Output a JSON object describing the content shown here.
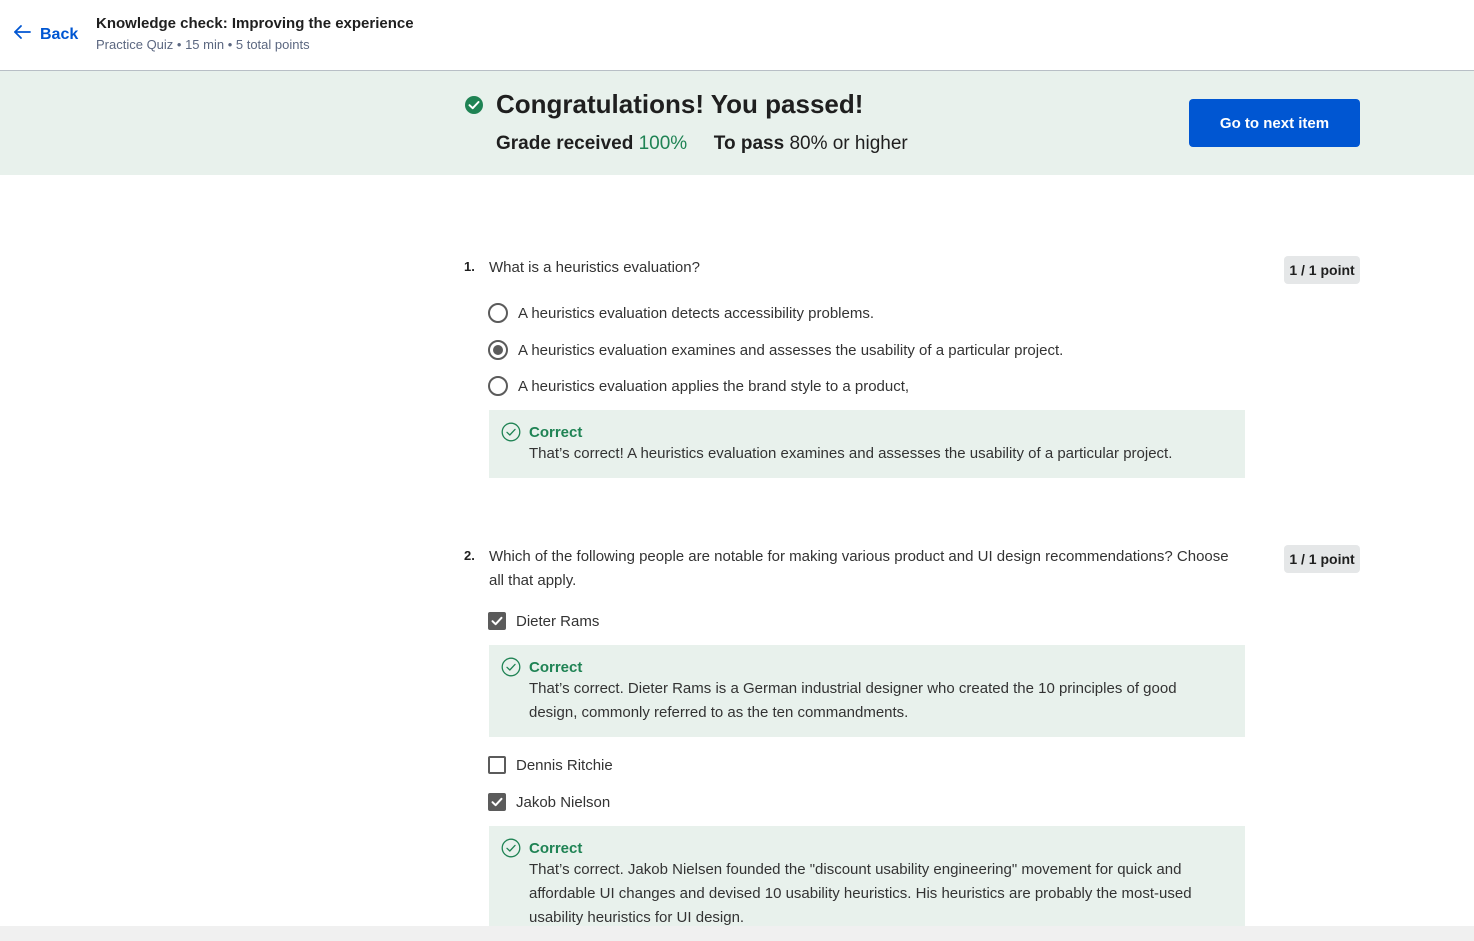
{
  "header": {
    "back_label": "Back",
    "title": "Knowledge check: Improving the experience",
    "subtitle": "Practice Quiz • 15 min • 5 total points"
  },
  "banner": {
    "heading": "Congratulations! You passed!",
    "grade_label": "Grade received",
    "grade_value": "100%",
    "pass_label": "To pass",
    "pass_value": "80% or higher",
    "next_button": "Go to next item",
    "colors": {
      "success": "#1f8354",
      "accent": "#0056d2",
      "banner_bg": "#e8f1ec"
    }
  },
  "questions": [
    {
      "number": "1.",
      "text": "What is a heuristics evaluation?",
      "points": "1 / 1 point",
      "type": "radio",
      "options": [
        {
          "label": "A heuristics evaluation detects accessibility problems.",
          "selected": false
        },
        {
          "label": "A heuristics evaluation examines and assesses the usability of a particular project.",
          "selected": true
        },
        {
          "label": "A heuristics evaluation applies the brand style to a product,",
          "selected": false
        }
      ],
      "feedback": {
        "title": "Correct",
        "text": "That’s correct! A heuristics evaluation examines and assesses the usability of a particular project."
      }
    },
    {
      "number": "2.",
      "text": "Which of the following people are notable for making various product and UI design recommendations? Choose all that apply.",
      "points": "1 / 1 point",
      "type": "checkbox",
      "options": [
        {
          "label": "Dieter Rams",
          "selected": true,
          "feedback": {
            "title": "Correct",
            "text": "That’s correct. Dieter Rams is a German industrial designer who created the 10 principles of good design, commonly referred to as the ten commandments."
          }
        },
        {
          "label": "Dennis Ritchie",
          "selected": false
        },
        {
          "label": "Jakob Nielson",
          "selected": true,
          "feedback": {
            "title": "Correct",
            "text": "That’s correct. Jakob Nielsen founded the \"discount usability engineering\" movement for quick and affordable UI changes and devised 10 usability heuristics. His heuristics are probably the most-used usability heuristics for UI design."
          }
        }
      ]
    }
  ]
}
